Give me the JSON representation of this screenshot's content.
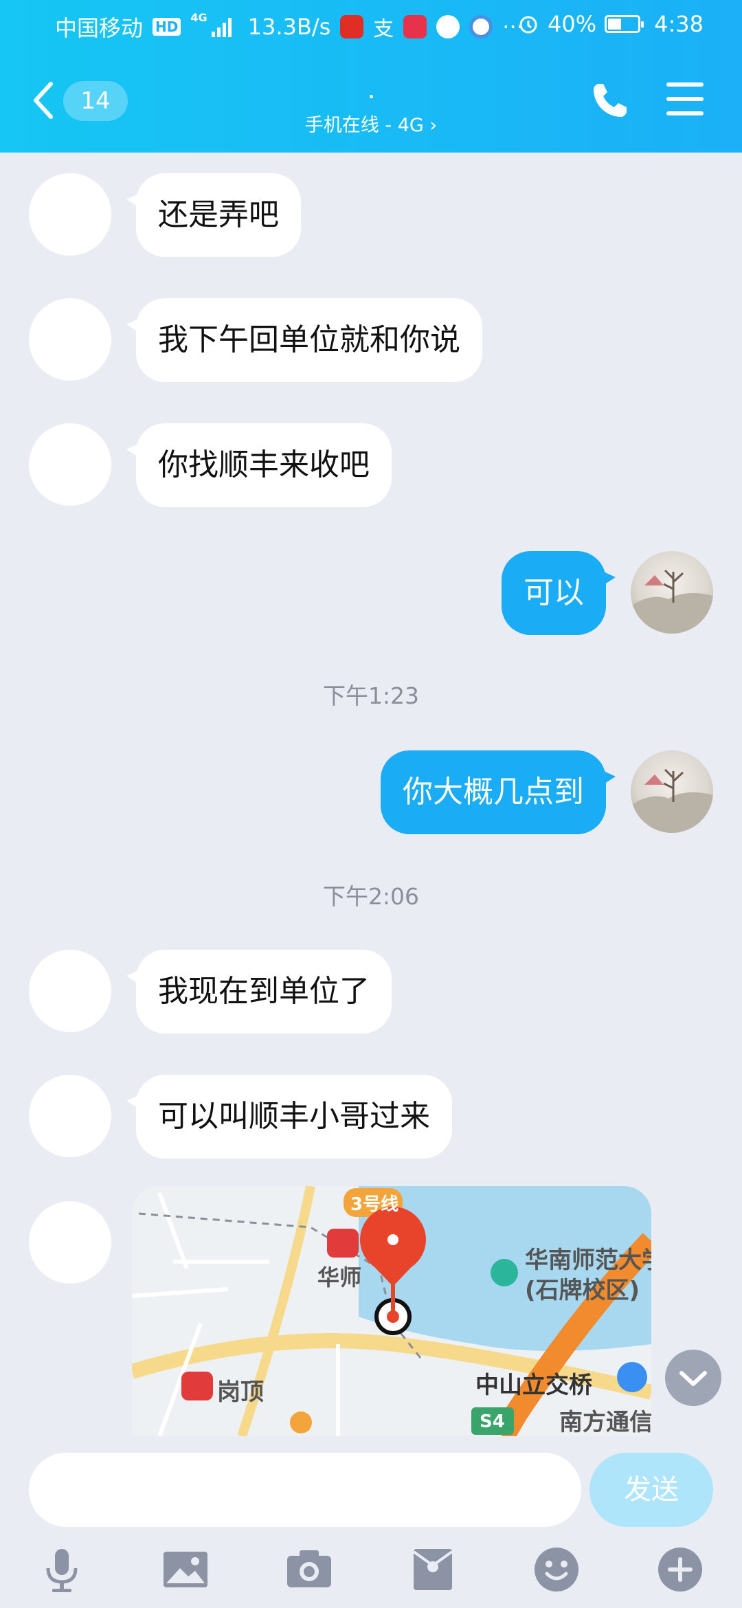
{
  "status_bar": {
    "carrier": "中国移动",
    "hd": "HD",
    "network": "4G",
    "speed": "13.3B/s",
    "more": "···",
    "battery": "40%",
    "time": "4:38"
  },
  "header": {
    "back_count": "14",
    "dot": "·",
    "subtitle": "手机在线 - 4G ›"
  },
  "messages": [
    {
      "side": "in",
      "text": "还是弄吧"
    },
    {
      "side": "in",
      "text": "我下午回单位就和你说"
    },
    {
      "side": "in",
      "text": "你找顺丰来收吧"
    },
    {
      "side": "out",
      "text": "可以"
    },
    {
      "type": "time",
      "text": "下午1:23"
    },
    {
      "side": "out",
      "text": "你大概几点到"
    },
    {
      "type": "time",
      "text": "下午2:06"
    },
    {
      "side": "in",
      "text": "我现在到单位了"
    },
    {
      "side": "in",
      "text": "可以叫顺丰小哥过来"
    }
  ],
  "map": {
    "line": "3号线",
    "station_1": "华师",
    "station_2": "岗顶",
    "poi_1": "华南师范大学",
    "poi_1b": "(石牌校区)",
    "bridge": "中山立交桥",
    "poi_2": "南方通信",
    "road": "S4"
  },
  "input": {
    "placeholder": "",
    "send_label": "发送"
  },
  "colors": {
    "header": "#1bb0f7",
    "out_bubble": "#1aacf5",
    "in_bubble": "#ffffff",
    "background": "#e9ecf3"
  }
}
